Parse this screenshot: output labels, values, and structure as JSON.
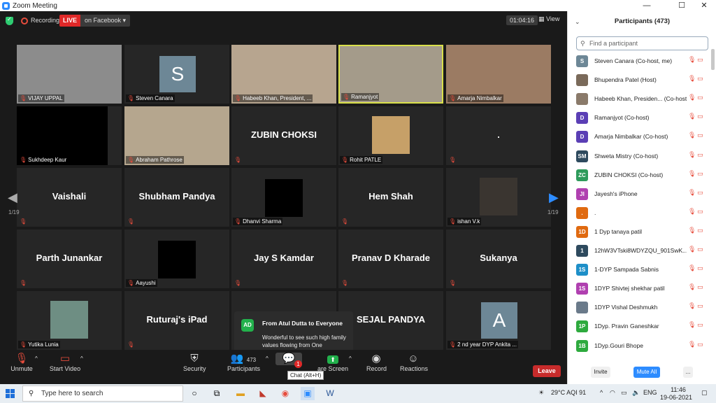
{
  "window": {
    "title": "Zoom Meeting",
    "controls": [
      "—",
      "☐",
      "✕"
    ]
  },
  "topbar": {
    "recording": "Recording",
    "live": "LIVE",
    "live_target": "on Facebook ▾",
    "timer": "01:04:16",
    "view": "View"
  },
  "tiles": [
    {
      "kind": "photo",
      "name": "VIJAY UPPAL",
      "bg": "#8c8c8c"
    },
    {
      "kind": "avatar",
      "letter": "S",
      "name": "Steven Canara"
    },
    {
      "kind": "photo",
      "name": "Habeeb Khan, President, ...",
      "bg": "#b7a58f"
    },
    {
      "kind": "photo",
      "name": "Ramanjyot",
      "bg": "#a49b8a",
      "highlight": true
    },
    {
      "kind": "photo",
      "name": "Amarja Nimbalkar",
      "bg": "#9b7b63"
    },
    {
      "kind": "black",
      "name": "Sukhdeep Kaur"
    },
    {
      "kind": "photo",
      "name": "Abraham Pathrose",
      "bg": "#b5a68e"
    },
    {
      "kind": "text",
      "big": "ZUBIN CHOKSI",
      "name": ""
    },
    {
      "kind": "smallphoto",
      "name": "Rohit PATLE",
      "bg": "#c6a068"
    },
    {
      "kind": "text",
      "big": ".",
      "name": ""
    },
    {
      "kind": "text",
      "big": "Vaishali",
      "name": ""
    },
    {
      "kind": "text",
      "big": "Shubham Pandya",
      "name": ""
    },
    {
      "kind": "black",
      "name": "Dhanvi Sharma"
    },
    {
      "kind": "text",
      "big": "Hem Shah",
      "name": ""
    },
    {
      "kind": "smallphoto",
      "name": "ishan V.k",
      "bg": "#3a3530"
    },
    {
      "kind": "text",
      "big": "Parth Junankar",
      "name": ""
    },
    {
      "kind": "black",
      "name": "Aayushi"
    },
    {
      "kind": "text",
      "big": "Jay S Kamdar",
      "name": ""
    },
    {
      "kind": "text",
      "big": "Pranav D Kharade",
      "name": ""
    },
    {
      "kind": "text",
      "big": "Sukanya",
      "name": ""
    },
    {
      "kind": "smallphoto",
      "name": "Yutika Lunia",
      "bg": "#6e8e83"
    },
    {
      "kind": "text",
      "big": "Ruturaj's iPad",
      "name": ""
    },
    {
      "kind": "text",
      "big": "",
      "name": ""
    },
    {
      "kind": "text",
      "big": "SEJAL PANDYA",
      "name": ""
    },
    {
      "kind": "avatar",
      "letter": "A",
      "name": "2 nd year DYP Ankita ..."
    }
  ],
  "pager": {
    "left": "1/19",
    "right": "1/19"
  },
  "chat_popup": {
    "initials": "AD",
    "from": "From Atul Dutta to Everyone",
    "message": "Wonderful to see such high family values flowing from One Generation to other......"
  },
  "controls": {
    "unmute": "Unmute",
    "start_video": "Start Video",
    "security": "Security",
    "participants": "Participants",
    "participants_count": "473",
    "chat_badge": "1",
    "chat_tooltip": "Chat (Alt+H)",
    "share": "are Screen",
    "record": "Record",
    "reactions": "Reactions",
    "leave": "Leave"
  },
  "sidebar": {
    "title": "Participants (473)",
    "search_placeholder": "Find a participant",
    "participants": [
      {
        "initials": "S",
        "color": "#6d8796",
        "name": "Steven Canara (Co-host, me)"
      },
      {
        "initials": "",
        "color": "#7a6a5a",
        "name": "Bhupendra Patel (Host)"
      },
      {
        "initials": "",
        "color": "#8a7a6a",
        "name": "Habeeb Khan, Presiden... (Co-host)"
      },
      {
        "initials": "D",
        "color": "#5b3fb5",
        "name": "Ramanjyot (Co-host)"
      },
      {
        "initials": "D",
        "color": "#5b3fb5",
        "name": "Amarja Nimbalkar (Co-host)"
      },
      {
        "initials": "SM",
        "color": "#2e4a5e",
        "name": "Shweta Mistry (Co-host)"
      },
      {
        "initials": "ZC",
        "color": "#2e9b5b",
        "name": "ZUBIN CHOKSI (Co-host)"
      },
      {
        "initials": "JI",
        "color": "#b040b0",
        "name": "Jayesh's iPhone"
      },
      {
        "initials": ".",
        "color": "#e06a10",
        "name": "."
      },
      {
        "initials": "1D",
        "color": "#e06a10",
        "name": "1 Dyp tanaya patil"
      },
      {
        "initials": "1",
        "color": "#2e4a5e",
        "name": "12hW3VTski8WDYZQU_901SwK..."
      },
      {
        "initials": "1S",
        "color": "#1e8fc8",
        "name": "1-DYP Sampada Sabnis"
      },
      {
        "initials": "1S",
        "color": "#b040b0",
        "name": "1DYP Shivtej shekhar patil"
      },
      {
        "initials": "",
        "color": "#6a7a8a",
        "name": "1DYP Vishal Deshmukh"
      },
      {
        "initials": "1P",
        "color": "#2eaa3e",
        "name": "1Dyp. Pravin Ganeshkar"
      },
      {
        "initials": "1B",
        "color": "#2eaa3e",
        "name": "1Dyp.Gouri Bhope"
      }
    ],
    "invite": "Invite",
    "mute_all": "Mute All",
    "more": "..."
  },
  "taskbar": {
    "search": "Type here to search",
    "weather": "29°C AQI 91",
    "lang": "ENG",
    "time": "11:46",
    "date": "19-06-2021"
  }
}
